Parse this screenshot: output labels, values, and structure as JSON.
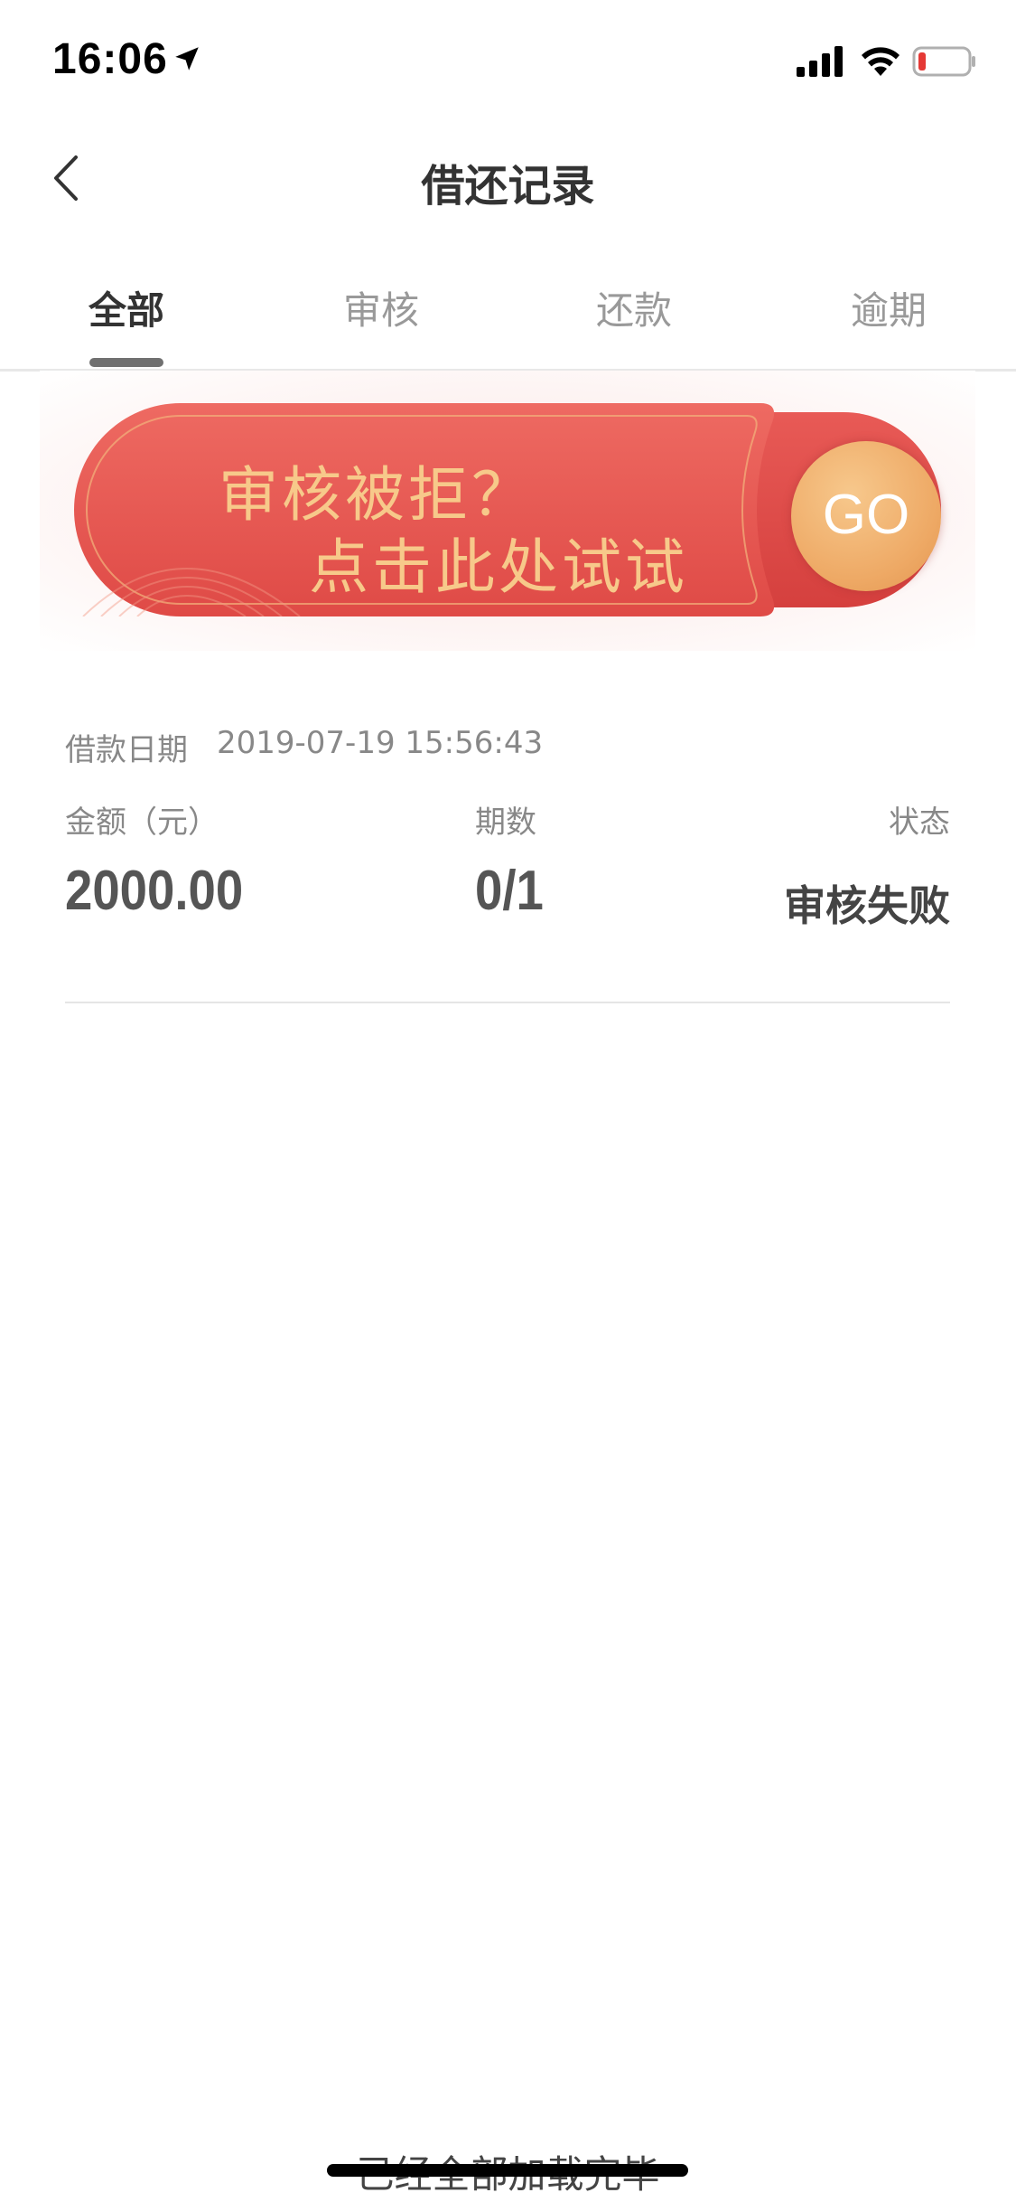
{
  "status_bar": {
    "time": "16:06",
    "battery_color": "#e53935"
  },
  "nav": {
    "title": "借还记录",
    "back_icon": "chevron-left-icon"
  },
  "tabs": [
    {
      "label": "全部",
      "active": true
    },
    {
      "label": "审核",
      "active": false
    },
    {
      "label": "还款",
      "active": false
    },
    {
      "label": "逾期",
      "active": false
    }
  ],
  "banner": {
    "line1": "审核被拒？",
    "line2": "点击此处试试",
    "go_label": "GO",
    "colors": {
      "red": "#e8504c",
      "gold_text": "#f7c98a",
      "go_orange": "#eea965"
    }
  },
  "record": {
    "date_label": "借款日期",
    "date_value": "2019-07-19 15:56:43",
    "amount_label": "金额（元）",
    "amount_value": "2000.00",
    "periods_label": "期数",
    "periods_value": "0/1",
    "status_label": "状态",
    "status_value": "审核失败"
  },
  "footer": {
    "text": "已经全部加载完毕"
  }
}
